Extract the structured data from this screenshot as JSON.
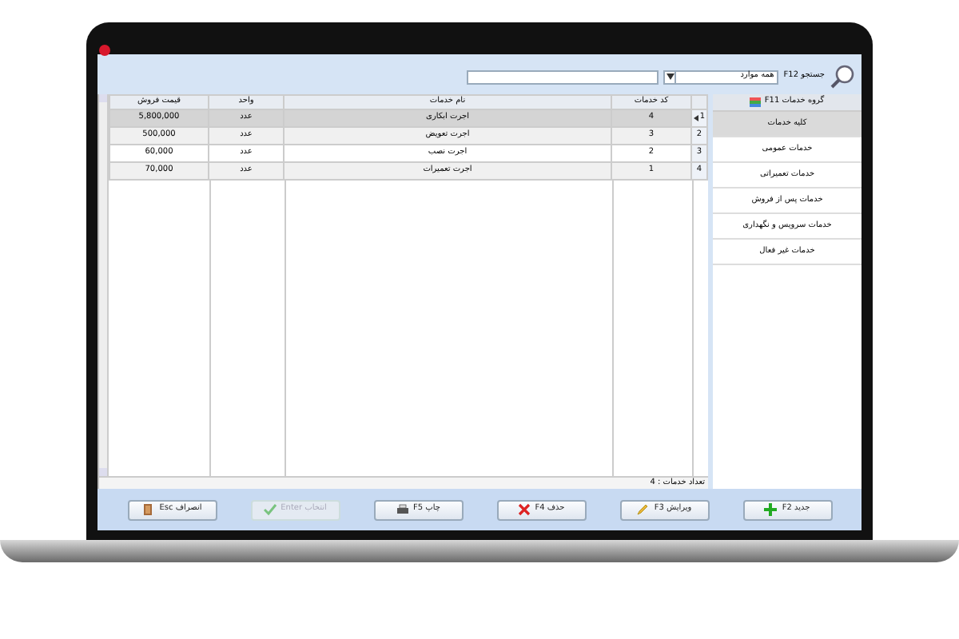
{
  "toolbar": {
    "search_label": "جستجو F12",
    "filter_value": "همه موارد"
  },
  "sidebar": {
    "title": "گروه خدمات F11",
    "items": [
      {
        "label": "کلیه خدمات",
        "selected": true
      },
      {
        "label": "خدمات عمومی",
        "selected": false
      },
      {
        "label": "خدمات تعمیراتی",
        "selected": false
      },
      {
        "label": "خدمات پس از فروش",
        "selected": false
      },
      {
        "label": "خدمات سرویس و نگهداری",
        "selected": false
      },
      {
        "label": "خدمات غیر فعال",
        "selected": false
      }
    ]
  },
  "table": {
    "columns": [
      "کد خدمات",
      "نام خدمات",
      "واحد",
      "قیمت فروش"
    ],
    "rows": [
      {
        "number": "1",
        "cells": [
          "4",
          "اجرت ابکاری",
          "عدد",
          "5,800,000"
        ],
        "selected": true
      },
      {
        "number": "2",
        "cells": [
          "3",
          "اجرت تعویض",
          "عدد",
          "500,000"
        ],
        "selected": false
      },
      {
        "number": "3",
        "cells": [
          "2",
          "اجرت نصب",
          "عدد",
          "60,000"
        ],
        "selected": false
      },
      {
        "number": "4",
        "cells": [
          "1",
          "اجرت تعمیرات",
          "عدد",
          "70,000"
        ],
        "selected": false
      }
    ],
    "footer": "تعداد خدمات : 4"
  },
  "buttons": [
    {
      "kind": "add",
      "label": "جدید F2",
      "disabled": false
    },
    {
      "kind": "edit",
      "label": "ویرایش F3",
      "disabled": false
    },
    {
      "kind": "delete",
      "label": "حذف F4",
      "disabled": false
    },
    {
      "kind": "print",
      "label": "چاپ F5",
      "disabled": false
    },
    {
      "kind": "select",
      "label": "انتخاب Enter",
      "disabled": true
    },
    {
      "kind": "exit",
      "label": "انصراف Esc",
      "disabled": false
    }
  ]
}
